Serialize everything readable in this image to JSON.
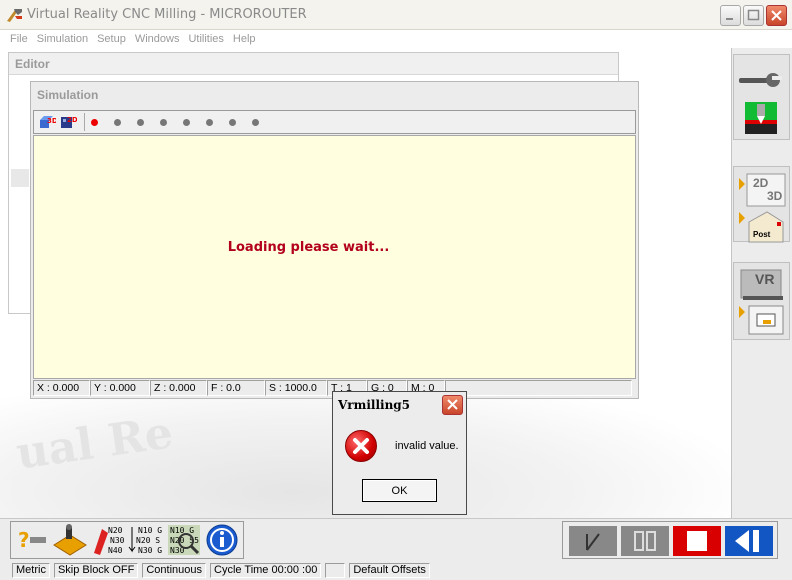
{
  "window": {
    "title": "Virtual Reality CNC Milling  -  MICROROUTER"
  },
  "menu": [
    "File",
    "Simulation",
    "Setup",
    "Windows",
    "Utilities",
    "Help"
  ],
  "editor": {
    "title": "Editor"
  },
  "simulation": {
    "title": "Simulation",
    "loading_text": "Loading please wait...",
    "toolbar_dots": 8,
    "active_dot_index": 0,
    "status": {
      "x": "X : 0.000",
      "y": "Y : 0.000",
      "z": "Z : 0.000",
      "f": "F : 0.0",
      "s": "S : 1000.0",
      "t": "T : 1",
      "g": "G : 0",
      "m": "M : 0"
    }
  },
  "dialog": {
    "title": "Vrmilling5",
    "message": "invalid value.",
    "ok_label": "OK",
    "icon": "error-icon"
  },
  "right_panel": {
    "btn_2d3d": {
      "top": "2D",
      "bottom": "3D"
    },
    "btn_post": "Post",
    "btn_vr": "VR"
  },
  "bottom_toolbar": {
    "nc_code_lines_1": [
      "N20 S",
      "N30",
      "N40 X"
    ],
    "nc_code_lines_2": [
      "N10 G",
      "N20 S",
      "N30 G"
    ],
    "nc_code_lines_3": [
      "N10 G",
      "N20 S5",
      "N30"
    ]
  },
  "statusbar": {
    "units": "Metric",
    "skip_block": "Skip Block OFF",
    "mode": "Continuous",
    "cycle_time": "Cycle Time 00:00 :00",
    "empty": "",
    "offsets": "Default Offsets"
  },
  "colors": {
    "sim_background": "#ffffe0",
    "loading_text": "#b3001b",
    "stop_button": "#d80000",
    "play_button": "#1256c4"
  }
}
